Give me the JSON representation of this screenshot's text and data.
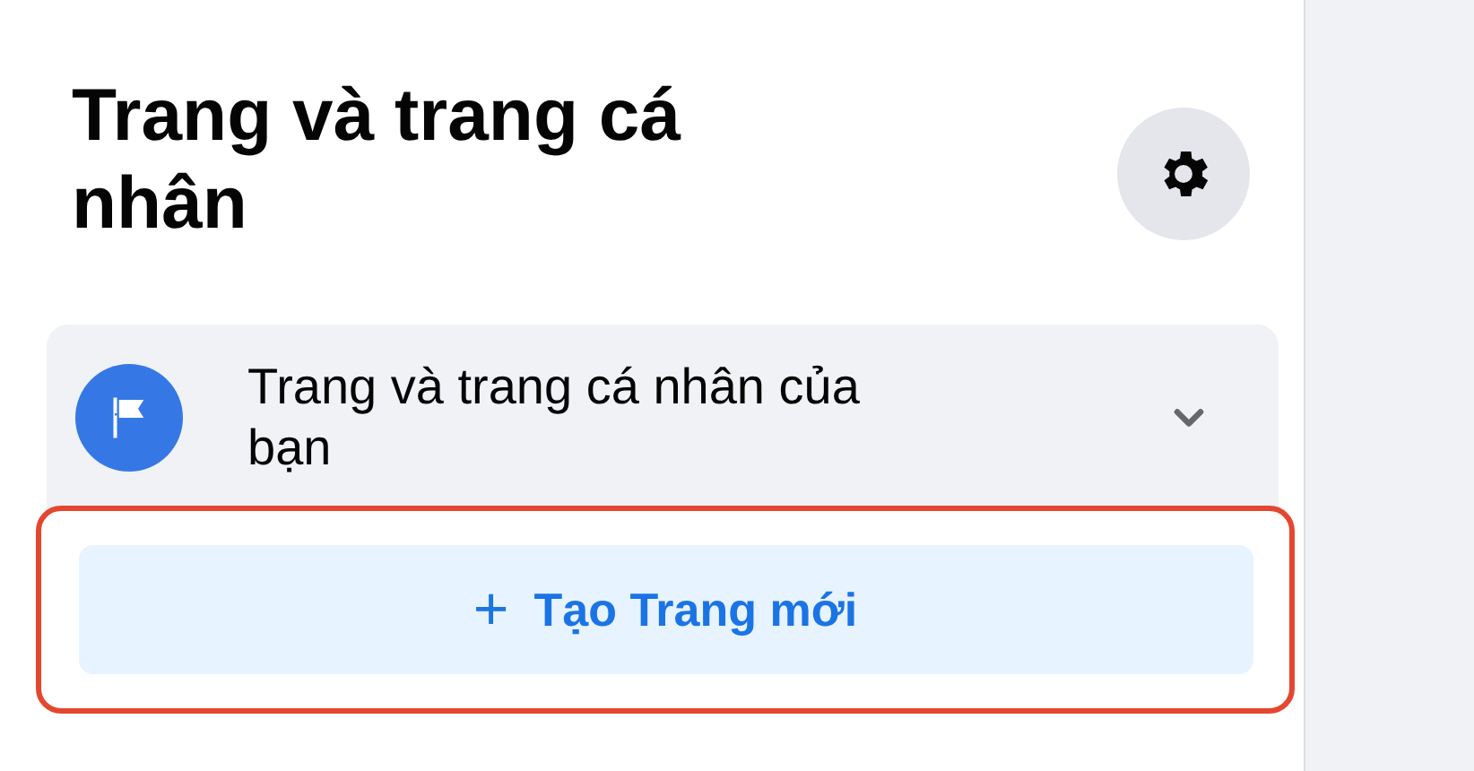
{
  "header": {
    "title": "Trang và trang cá nhân"
  },
  "menu_item": {
    "label": "Trang và trang cá nhân của bạn",
    "expanded": false
  },
  "create_button": {
    "icon": "+",
    "label": "Tạo Trang mới",
    "highlighted": true
  }
}
